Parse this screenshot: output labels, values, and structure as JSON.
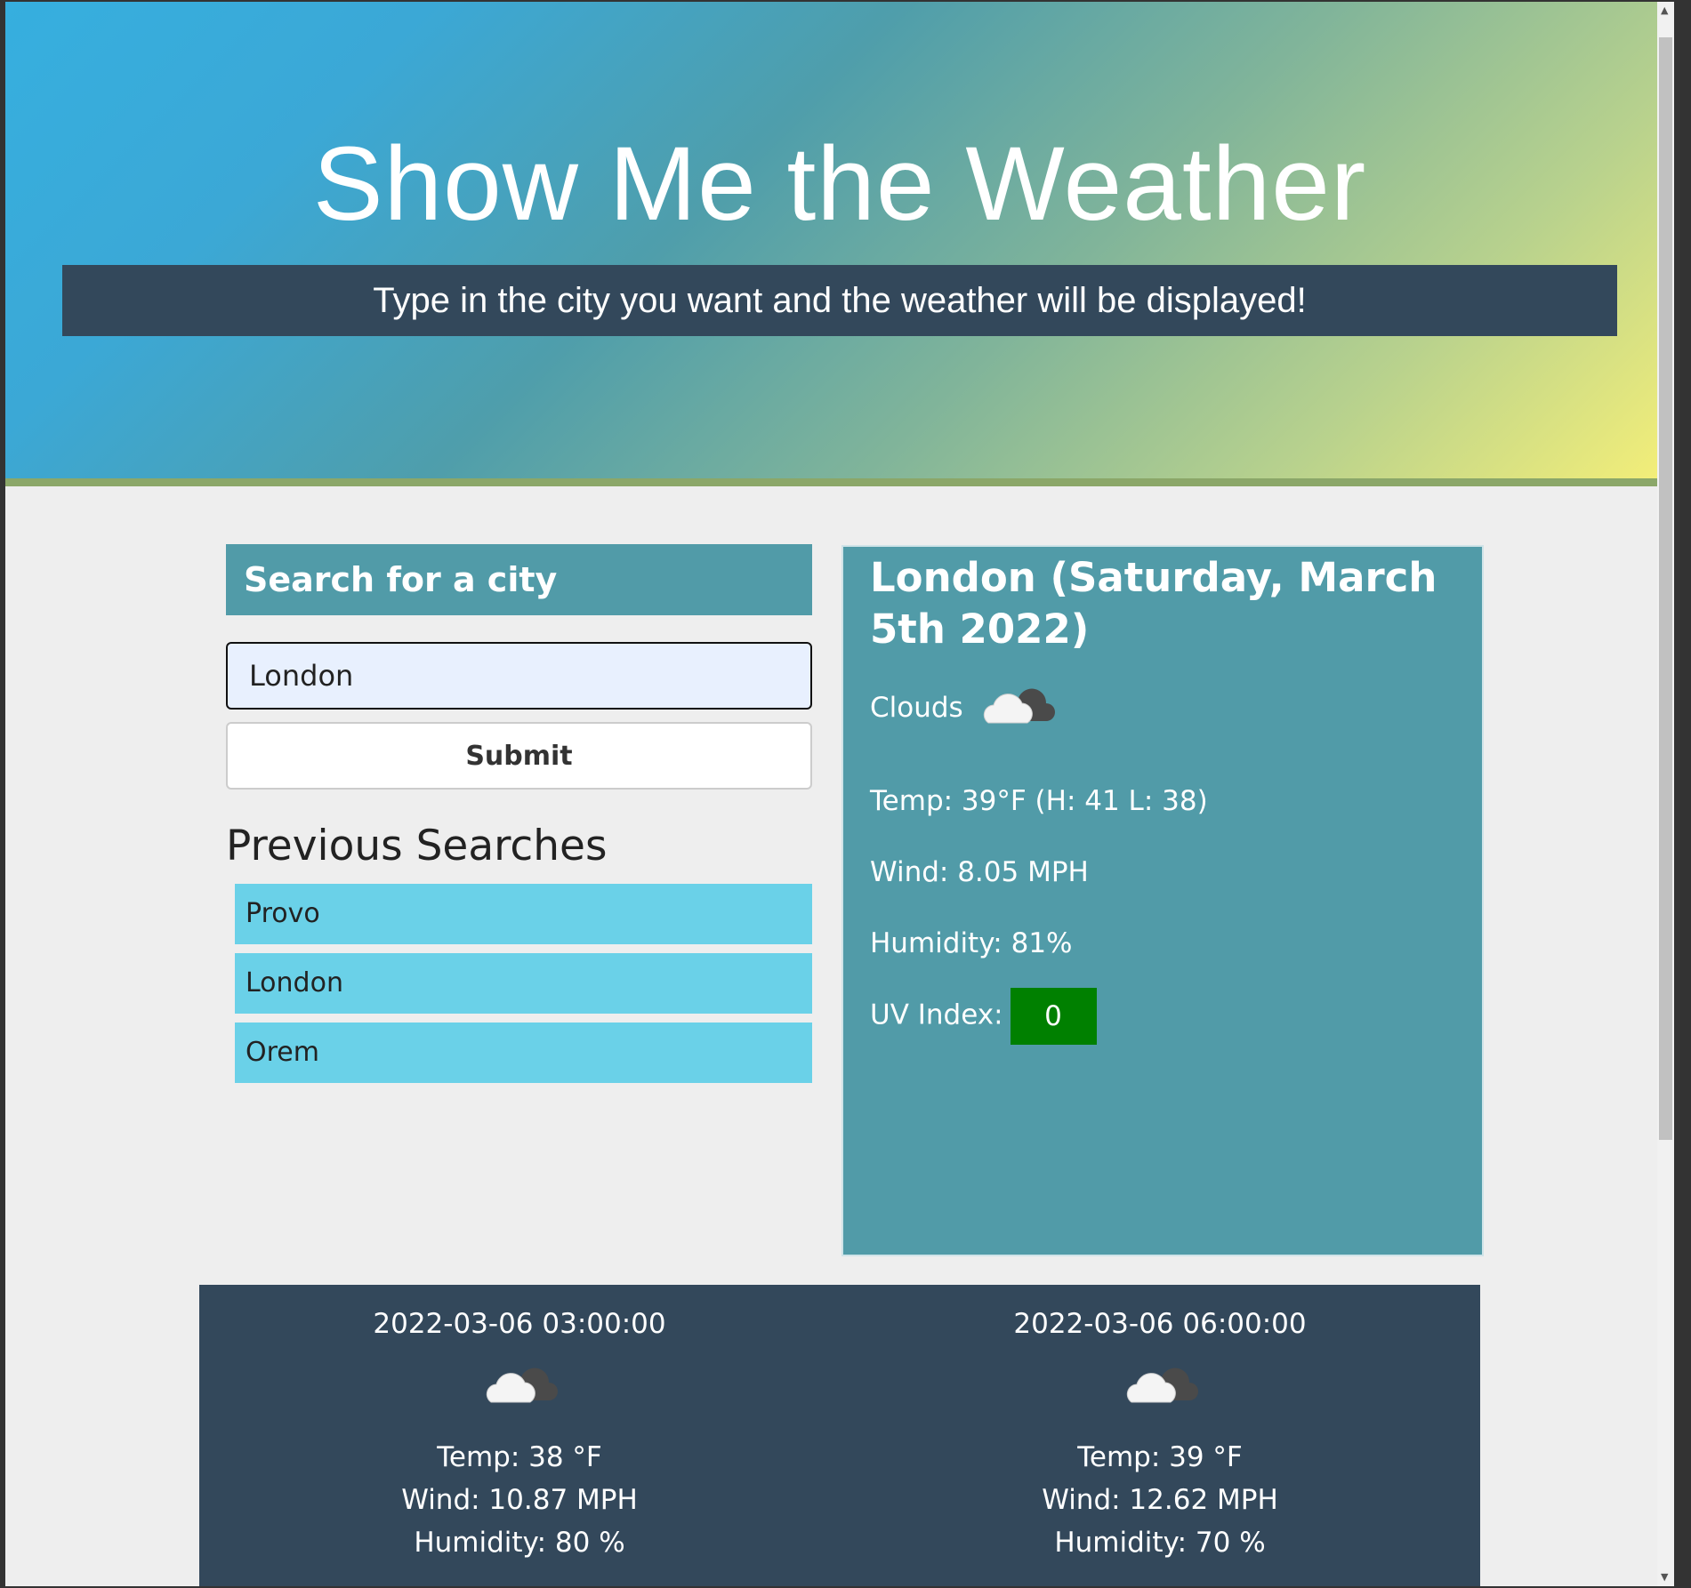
{
  "header": {
    "title": "Show Me the Weather",
    "subtitle": "Type in the city you want and the weather will be displayed!"
  },
  "search": {
    "heading": "Search for a city",
    "input_value": "London",
    "submit_label": "Submit"
  },
  "previous": {
    "title": "Previous Searches",
    "items": [
      "Provo",
      "London",
      "Orem"
    ]
  },
  "current": {
    "city": "London (Saturday, March 5th 2022)",
    "condition": "Clouds",
    "icon": "cloud-icon",
    "temp": "Temp: 39°F (H: 41 L: 38)",
    "wind": "Wind: 8.05 MPH",
    "humidity": "Humidity: 81%",
    "uv_label": "UV Index:",
    "uv_value": "0",
    "uv_color": "#008000"
  },
  "forecast": [
    {
      "date": "2022-03-06 03:00:00",
      "icon": "cloud-icon",
      "temp": "Temp: 38 °F",
      "wind": "Wind: 10.87 MPH",
      "humidity": "Humidity: 80 %"
    },
    {
      "date": "2022-03-06 06:00:00",
      "icon": "cloud-icon",
      "temp": "Temp: 39 °F",
      "wind": "Wind: 12.62 MPH",
      "humidity": "Humidity: 70 %"
    }
  ]
}
